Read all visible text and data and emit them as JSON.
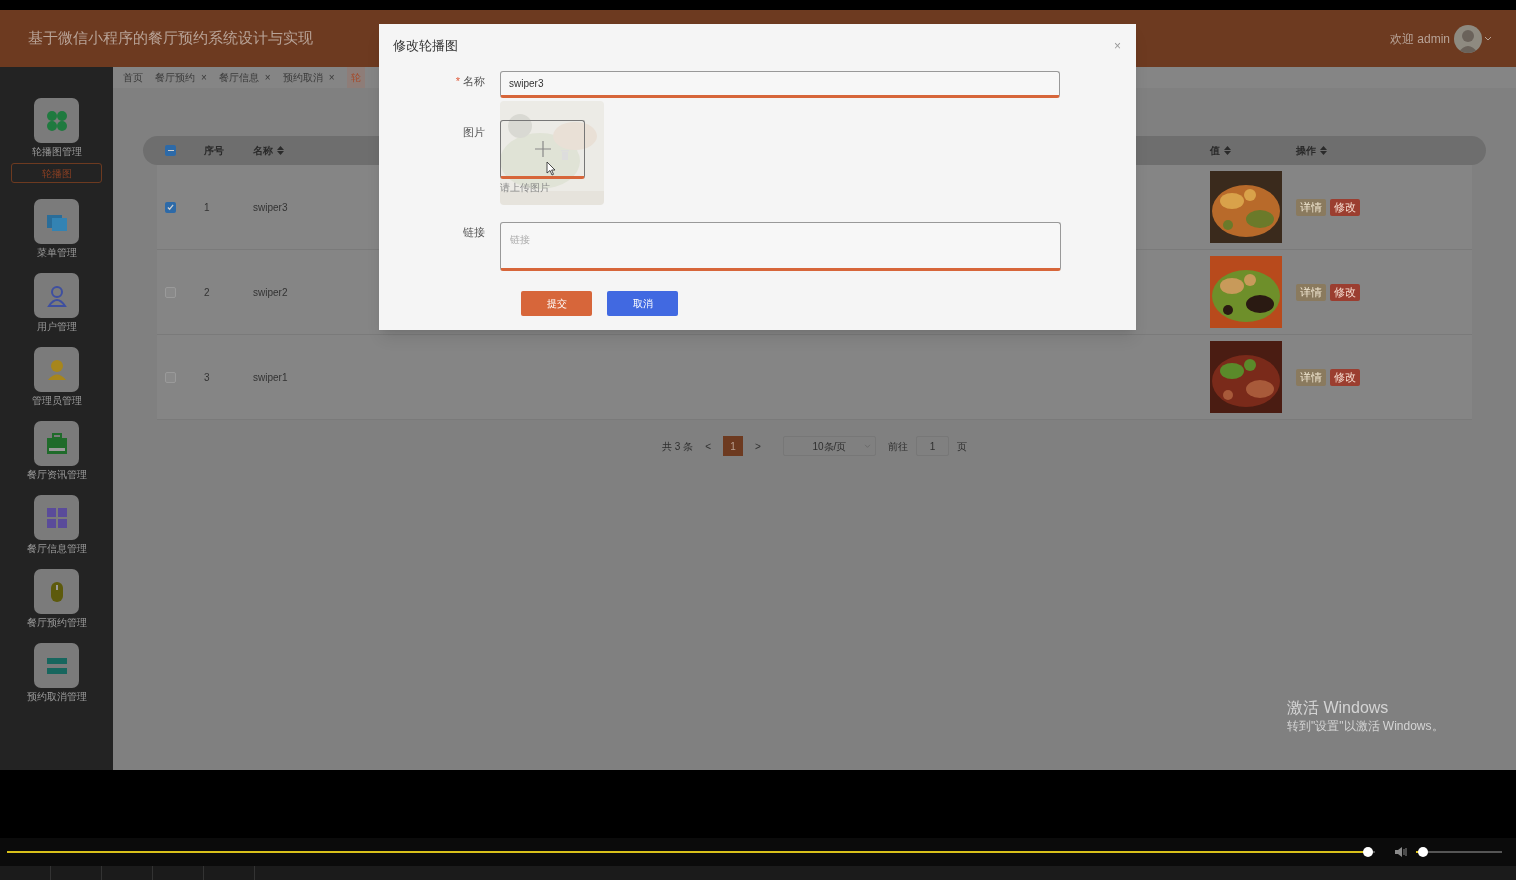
{
  "header": {
    "title": "基于微信小程序的餐厅预约系统设计与实现",
    "welcome": "欢迎 admin"
  },
  "sidebar": {
    "items": [
      {
        "label": "轮播图管理",
        "children": [
          {
            "label": "轮播图",
            "selected": true
          }
        ]
      },
      {
        "label": "菜单管理"
      },
      {
        "label": "用户管理"
      },
      {
        "label": "管理员管理"
      },
      {
        "label": "餐厅资讯管理"
      },
      {
        "label": "餐厅信息管理"
      },
      {
        "label": "餐厅预约管理"
      },
      {
        "label": "预约取消管理"
      }
    ]
  },
  "tabs": [
    {
      "label": "首页",
      "selected": false
    },
    {
      "label": "餐厅预约",
      "close": "×",
      "selected": false
    },
    {
      "label": "餐厅信息",
      "close": "×",
      "selected": false
    },
    {
      "label": "预约取消",
      "close": "×",
      "selected": false
    },
    {
      "label": "轮",
      "selected": true
    }
  ],
  "table": {
    "columns": [
      {
        "label": "序号",
        "sortable": false
      },
      {
        "label": "名称",
        "sortable": true
      },
      {
        "label": "值",
        "sortable": true
      },
      {
        "label": "操作",
        "sortable": true
      }
    ],
    "header_checkbox": {
      "indeterminate": true
    },
    "rows": [
      {
        "index": "1",
        "name": "swiper3",
        "checked": true,
        "actions": [
          "详情",
          "修改"
        ]
      },
      {
        "index": "2",
        "name": "swiper2",
        "checked": false,
        "actions": [
          "详情",
          "修改"
        ]
      },
      {
        "index": "3",
        "name": "swiper1",
        "checked": false,
        "actions": [
          "详情",
          "修改"
        ]
      }
    ]
  },
  "pagination": {
    "total": "共 3 条",
    "prev": "<",
    "pages": [
      {
        "label": "1",
        "selected": true
      }
    ],
    "next": ">",
    "page_size": "10条/页",
    "goto_label": "前往",
    "goto_value": "1",
    "goto_suffix": "页"
  },
  "dialog": {
    "title": "修改轮播图",
    "close": "×",
    "fields": [
      {
        "kind": "input",
        "label": "名称",
        "required_mark": "*",
        "value": "swiper3"
      },
      {
        "kind": "upload",
        "label": "图片",
        "hint": "请上传图片"
      },
      {
        "kind": "textarea",
        "label": "链接",
        "placeholder": "链接"
      }
    ],
    "buttons": [
      {
        "label": "提交",
        "kind": "primary"
      },
      {
        "label": "取消",
        "kind": "secondary"
      }
    ]
  },
  "watermark": {
    "title": "激活 Windows",
    "subtitle": "转到\"设置\"以激活 Windows。"
  },
  "player": {
    "seek": {
      "level": 0.995
    },
    "volume": {
      "level": 0.08
    }
  }
}
